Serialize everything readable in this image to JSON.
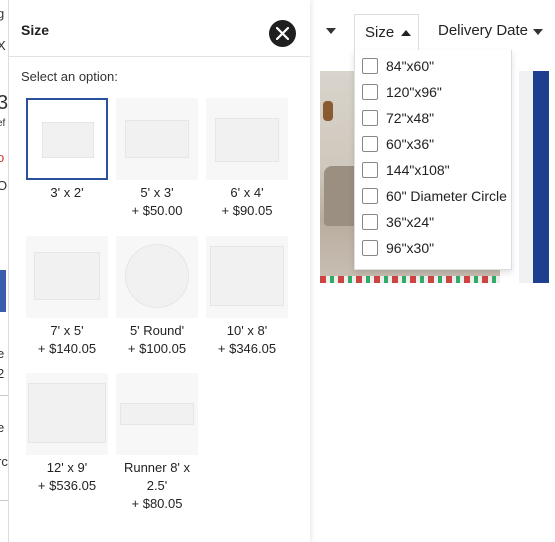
{
  "background_page": {
    "edge_text": [
      "g",
      "X",
      "3",
      "ef",
      "o",
      "O",
      "e",
      "2",
      "e",
      "rc"
    ]
  },
  "panel": {
    "title": "Size",
    "close_icon": "close-icon",
    "select_label": "Select an option:",
    "selected_color": "#2a4f9c",
    "options": [
      {
        "name": "3' x 2'",
        "price": "",
        "selected": true
      },
      {
        "name": "5' x 3'",
        "price": "+ $50.00"
      },
      {
        "name": "6' x 4'",
        "price": "+ $90.05"
      },
      {
        "name": "7' x 5'",
        "price": "+ $140.05"
      },
      {
        "name": "5' Round'",
        "price": "+ $100.05"
      },
      {
        "name": "10' x 8'",
        "price": "+ $346.05"
      },
      {
        "name": "12' x 9'",
        "price": "+ $536.05"
      },
      {
        "name": "Runner 8' x 2.5'",
        "price": "+ $80.05"
      }
    ]
  },
  "filters": {
    "size_label": "Size",
    "delivery_label": "Delivery Date",
    "size_options": [
      "84\"x60\"",
      "120\"x96\"",
      "72\"x48\"",
      "60\"x36\"",
      "144\"x108\"",
      "60\" Diameter Circle",
      "36\"x24\"",
      "96\"x30\""
    ]
  }
}
